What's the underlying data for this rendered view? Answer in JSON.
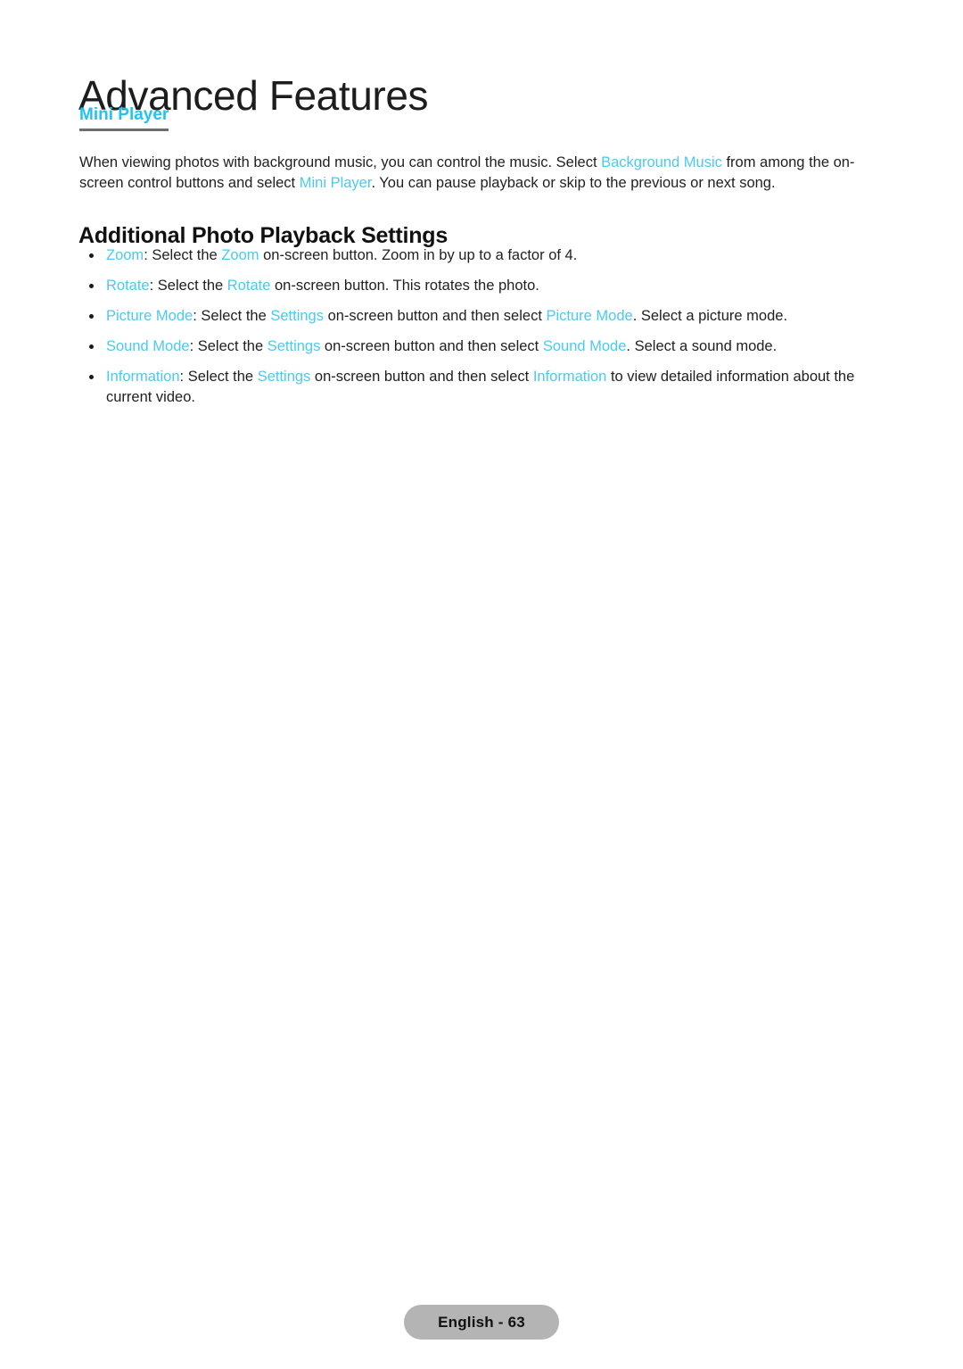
{
  "page": {
    "chapter_title": "Advanced Features",
    "background_color": "#ffffff",
    "link_color": "#4cc9f0",
    "heading_link_color": "#24c1f4"
  },
  "sub_heading": {
    "label": "Mini Player"
  },
  "intro": {
    "rich": [
      {
        "text": "When viewing photos with background music, you can control the music. Select ",
        "style": "plain"
      },
      {
        "text": "Background Music",
        "style": "link"
      },
      {
        "text": " from among the on-screen control buttons and select ",
        "style": "plain"
      },
      {
        "text": "Mini Player",
        "style": "link"
      },
      {
        "text": ". You can pause playback or skip to the previous or next song.",
        "style": "plain"
      }
    ]
  },
  "section_heading": {
    "label": "Additional Photo Playback Settings"
  },
  "bullets": [
    {
      "name": "zoom",
      "rich": [
        {
          "text": "Zoom",
          "style": "link"
        },
        {
          "text": ": Select the ",
          "style": "plain"
        },
        {
          "text": "Zoom",
          "style": "link"
        },
        {
          "text": " on-screen button. Zoom in by up to a factor of 4.",
          "style": "plain"
        }
      ]
    },
    {
      "name": "rotate",
      "rich": [
        {
          "text": "Rotate",
          "style": "link"
        },
        {
          "text": ": Select the ",
          "style": "plain"
        },
        {
          "text": "Rotate",
          "style": "link"
        },
        {
          "text": " on-screen button. This rotates the photo.",
          "style": "plain"
        }
      ]
    },
    {
      "name": "picture-mode",
      "rich": [
        {
          "text": "Picture Mode",
          "style": "link"
        },
        {
          "text": ": Select the ",
          "style": "plain"
        },
        {
          "text": "Settings",
          "style": "link"
        },
        {
          "text": " on-screen button and then select ",
          "style": "plain"
        },
        {
          "text": "Picture Mode",
          "style": "link"
        },
        {
          "text": ". Select a picture mode.",
          "style": "plain"
        }
      ]
    },
    {
      "name": "sound-mode",
      "rich": [
        {
          "text": "Sound Mode",
          "style": "link"
        },
        {
          "text": ": Select the ",
          "style": "plain"
        },
        {
          "text": "Settings",
          "style": "link"
        },
        {
          "text": " on-screen button and then select ",
          "style": "plain"
        },
        {
          "text": "Sound Mode",
          "style": "link"
        },
        {
          "text": ". Select a sound mode.",
          "style": "plain"
        }
      ]
    },
    {
      "name": "information",
      "rich": [
        {
          "text": "Information",
          "style": "link"
        },
        {
          "text": ": Select the ",
          "style": "plain"
        },
        {
          "text": "Settings",
          "style": "link"
        },
        {
          "text": " on-screen button and then select ",
          "style": "plain"
        },
        {
          "text": "Information",
          "style": "link"
        },
        {
          "text": " to view detailed information about the current video.",
          "style": "plain"
        }
      ]
    }
  ],
  "footer": {
    "label": "English - 63"
  }
}
